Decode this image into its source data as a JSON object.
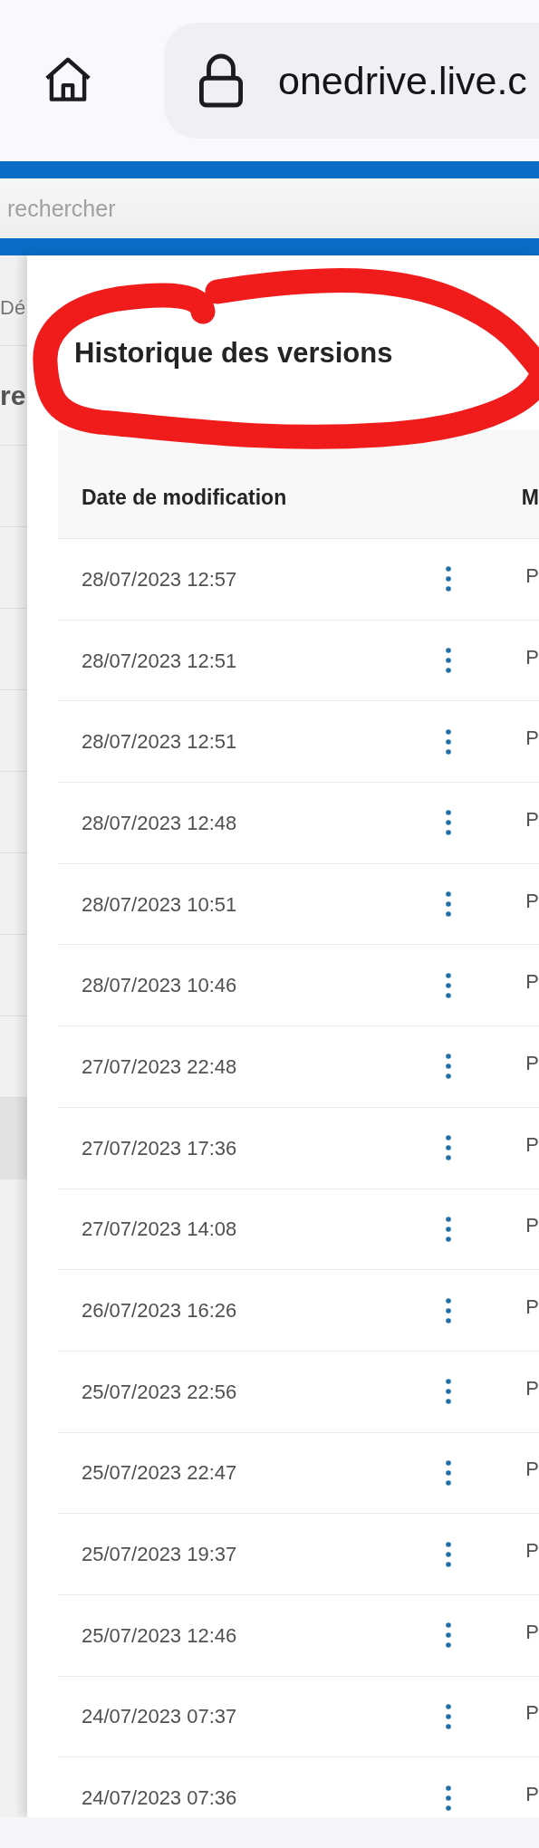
{
  "browser": {
    "url": "onedrive.live.c"
  },
  "search": {
    "placeholder": "rechercher"
  },
  "background_labels": [
    "Dé",
    "re"
  ],
  "panel": {
    "title": "Historique des versions",
    "table": {
      "columns": [
        "Date de modification",
        "M"
      ],
      "rows": [
        {
          "date": "28/07/2023 12:57",
          "column_2": "P"
        },
        {
          "date": "28/07/2023 12:51",
          "column_2": "P"
        },
        {
          "date": "28/07/2023 12:51",
          "column_2": "P"
        },
        {
          "date": "28/07/2023 12:48",
          "column_2": "P"
        },
        {
          "date": "28/07/2023 10:51",
          "column_2": "P"
        },
        {
          "date": "28/07/2023 10:46",
          "column_2": "P"
        },
        {
          "date": "27/07/2023 22:48",
          "column_2": "P"
        },
        {
          "date": "27/07/2023 17:36",
          "column_2": "P"
        },
        {
          "date": "27/07/2023 14:08",
          "column_2": "P"
        },
        {
          "date": "26/07/2023 16:26",
          "column_2": "P"
        },
        {
          "date": "25/07/2023 22:56",
          "column_2": "P"
        },
        {
          "date": "25/07/2023 22:47",
          "column_2": "P"
        },
        {
          "date": "25/07/2023 19:37",
          "column_2": "P"
        },
        {
          "date": "25/07/2023 12:46",
          "column_2": "P"
        },
        {
          "date": "24/07/2023 07:37",
          "column_2": "P"
        },
        {
          "date": "24/07/2023 07:36",
          "column_2": "P"
        }
      ]
    }
  }
}
